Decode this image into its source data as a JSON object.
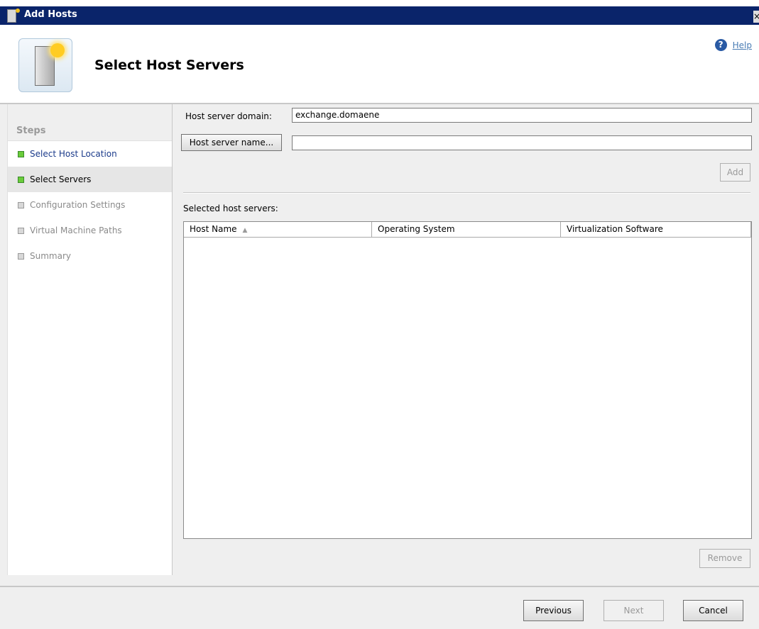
{
  "window": {
    "title": "Add Hosts",
    "close_glyph": "×"
  },
  "header": {
    "title": "Select Host Servers",
    "help_label": "Help"
  },
  "steps": {
    "heading": "Steps",
    "items": [
      {
        "label": "Select Host Location",
        "state": "done"
      },
      {
        "label": "Select Servers",
        "state": "active"
      },
      {
        "label": "Configuration Settings",
        "state": "pending"
      },
      {
        "label": "Virtual Machine Paths",
        "state": "pending"
      },
      {
        "label": "Summary",
        "state": "pending"
      }
    ]
  },
  "form": {
    "domain_label": "Host server domain:",
    "domain_value": "exchange.domaene",
    "name_button": "Host server name...",
    "name_value": "",
    "add_button": "Add",
    "selected_label": "Selected host servers:",
    "columns": [
      "Host Name",
      "Operating System",
      "Virtualization Software"
    ],
    "sort_glyph": "▲",
    "remove_button": "Remove"
  },
  "footer": {
    "previous": "Previous",
    "next": "Next",
    "cancel": "Cancel"
  },
  "colors": {
    "title_bar": "#0a246a",
    "panel": "#efefef",
    "step_done": "#6acc3a",
    "help_link": "#4a7cb4"
  }
}
